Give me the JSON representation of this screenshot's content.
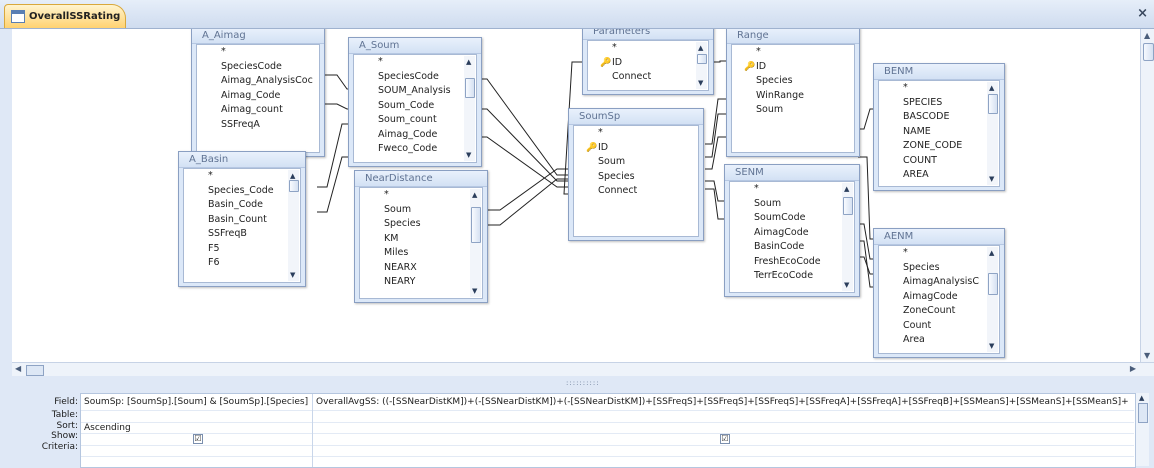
{
  "document_tab": {
    "title": "OverallSSRating",
    "icon": "query-icon"
  },
  "tables": {
    "a_aimag": {
      "name": "A_Aimag",
      "fields": [
        "*",
        "SpeciesCode",
        "Aimag_AnalysisCoc",
        "Aimag_Code",
        "Aimag_count",
        "SSFreqA"
      ]
    },
    "a_soum": {
      "name": "A_Soum",
      "fields": [
        "*",
        "SpeciesCode",
        "SOUM_Analysis",
        "Soum_Code",
        "Soum_count",
        "Aimag_Code",
        "Fweco_Code"
      ]
    },
    "a_basin": {
      "name": "A_Basin",
      "fields": [
        "*",
        "Species_Code",
        "Basin_Code",
        "Basin_Count",
        "SSFreqB",
        "F5",
        "F6"
      ]
    },
    "near_distance": {
      "name": "NearDistance",
      "fields": [
        "*",
        "Soum",
        "Species",
        "KM",
        "Miles",
        "NEARX",
        "NEARY"
      ]
    },
    "parameters": {
      "name": "Parameters",
      "fields": [
        "*",
        "ID",
        "Connect"
      ],
      "key_field": "ID"
    },
    "soumsp": {
      "name": "SoumSp",
      "fields": [
        "*",
        "ID",
        "Soum",
        "Species",
        "Connect"
      ],
      "key_field": "ID"
    },
    "range": {
      "name": "Range",
      "fields": [
        "*",
        "ID",
        "Species",
        "WinRange",
        "Soum"
      ],
      "key_field": "ID"
    },
    "senm": {
      "name": "SENM",
      "fields": [
        "*",
        "Soum",
        "SoumCode",
        "AimagCode",
        "BasinCode",
        "FreshEcoCode",
        "TerrEcoCode"
      ]
    },
    "benm": {
      "name": "BENM",
      "fields": [
        "*",
        "SPECIES",
        "BASCODE",
        "NAME",
        "ZONE_CODE",
        "COUNT",
        "AREA"
      ]
    },
    "aenm": {
      "name": "AENM",
      "fields": [
        "*",
        "Species",
        "AimagAnalysisC",
        "AimagCode",
        "ZoneCount",
        "Count",
        "Area"
      ]
    }
  },
  "grid": {
    "row_labels": [
      "Field:",
      "Table:",
      "Sort:",
      "Show:",
      "Criteria:"
    ],
    "columns": [
      {
        "field": "SoumSp: [SoumSp].[Soum] & [SoumSp].[Species]",
        "table": "",
        "sort": "Ascending",
        "show": "☑",
        "criteria": ""
      },
      {
        "field": "OverallAvgSS: ((-[SSNearDistKM])+(-[SSNearDistKM])+(-[SSNearDistKM])+[SSFreqS]+[SSFreqS]+[SSFreqS]+[SSFreqA]+[SSFreqA]+[SSFreqB]+[SSMeanS]+[SSMeanS]+[SSMeanS]+",
        "table": "",
        "sort": "",
        "show": "☑",
        "criteria": ""
      }
    ]
  },
  "splitter_grip": "::::::::::"
}
